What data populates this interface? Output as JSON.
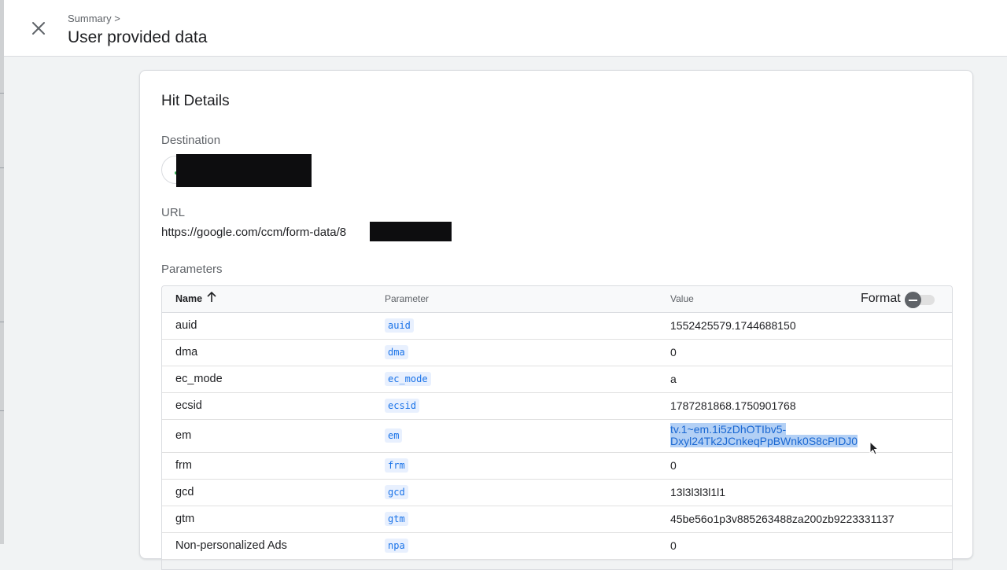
{
  "header": {
    "breadcrumb": "Summary >",
    "title": "User provided data"
  },
  "hit_details": {
    "title": "Hit Details",
    "destination_label": "Destination",
    "url_label": "URL",
    "url_value": "https://google.com/ccm/form-data/8",
    "parameters_label": "Parameters"
  },
  "table": {
    "columns": {
      "name": "Name",
      "parameter": "Parameter",
      "value": "Value"
    },
    "format_label": "Format",
    "format_enabled": false,
    "sort_direction": "ascending",
    "rows": [
      {
        "name": "auid",
        "param": "auid",
        "value": "1552425579.1744688150"
      },
      {
        "name": "dma",
        "param": "dma",
        "value": "0"
      },
      {
        "name": "ec_mode",
        "param": "ec_mode",
        "value": "a"
      },
      {
        "name": "ecsid",
        "param": "ecsid",
        "value": "1787281868.1750901768"
      },
      {
        "name": "em",
        "param": "em",
        "value_line1": "tv.1~em.1i5zDhOTIbv5-",
        "value_line2": "Dxyl24Tk2JCnkeqPpBWnk0S8cPIDJ0",
        "selected": true
      },
      {
        "name": "frm",
        "param": "frm",
        "value": "0"
      },
      {
        "name": "gcd",
        "param": "gcd",
        "value": "13l3l3l3l1l1"
      },
      {
        "name": "gtm",
        "param": "gtm",
        "value": "45be56o1p3v885263488za200zb9223331137"
      },
      {
        "name": "Non-personalized Ads",
        "param": "npa",
        "value": "0"
      }
    ]
  },
  "icons": {
    "close": "close-icon",
    "sort": "arrow-up-icon",
    "toggle": "toggle-off-icon",
    "cursor": "mouse-pointer-icon"
  },
  "colors": {
    "param_chip_bg": "#e8f0fe",
    "param_chip_text": "#1a73e8",
    "selection": "#b3d0f5",
    "redaction": "#0d0d0f"
  }
}
